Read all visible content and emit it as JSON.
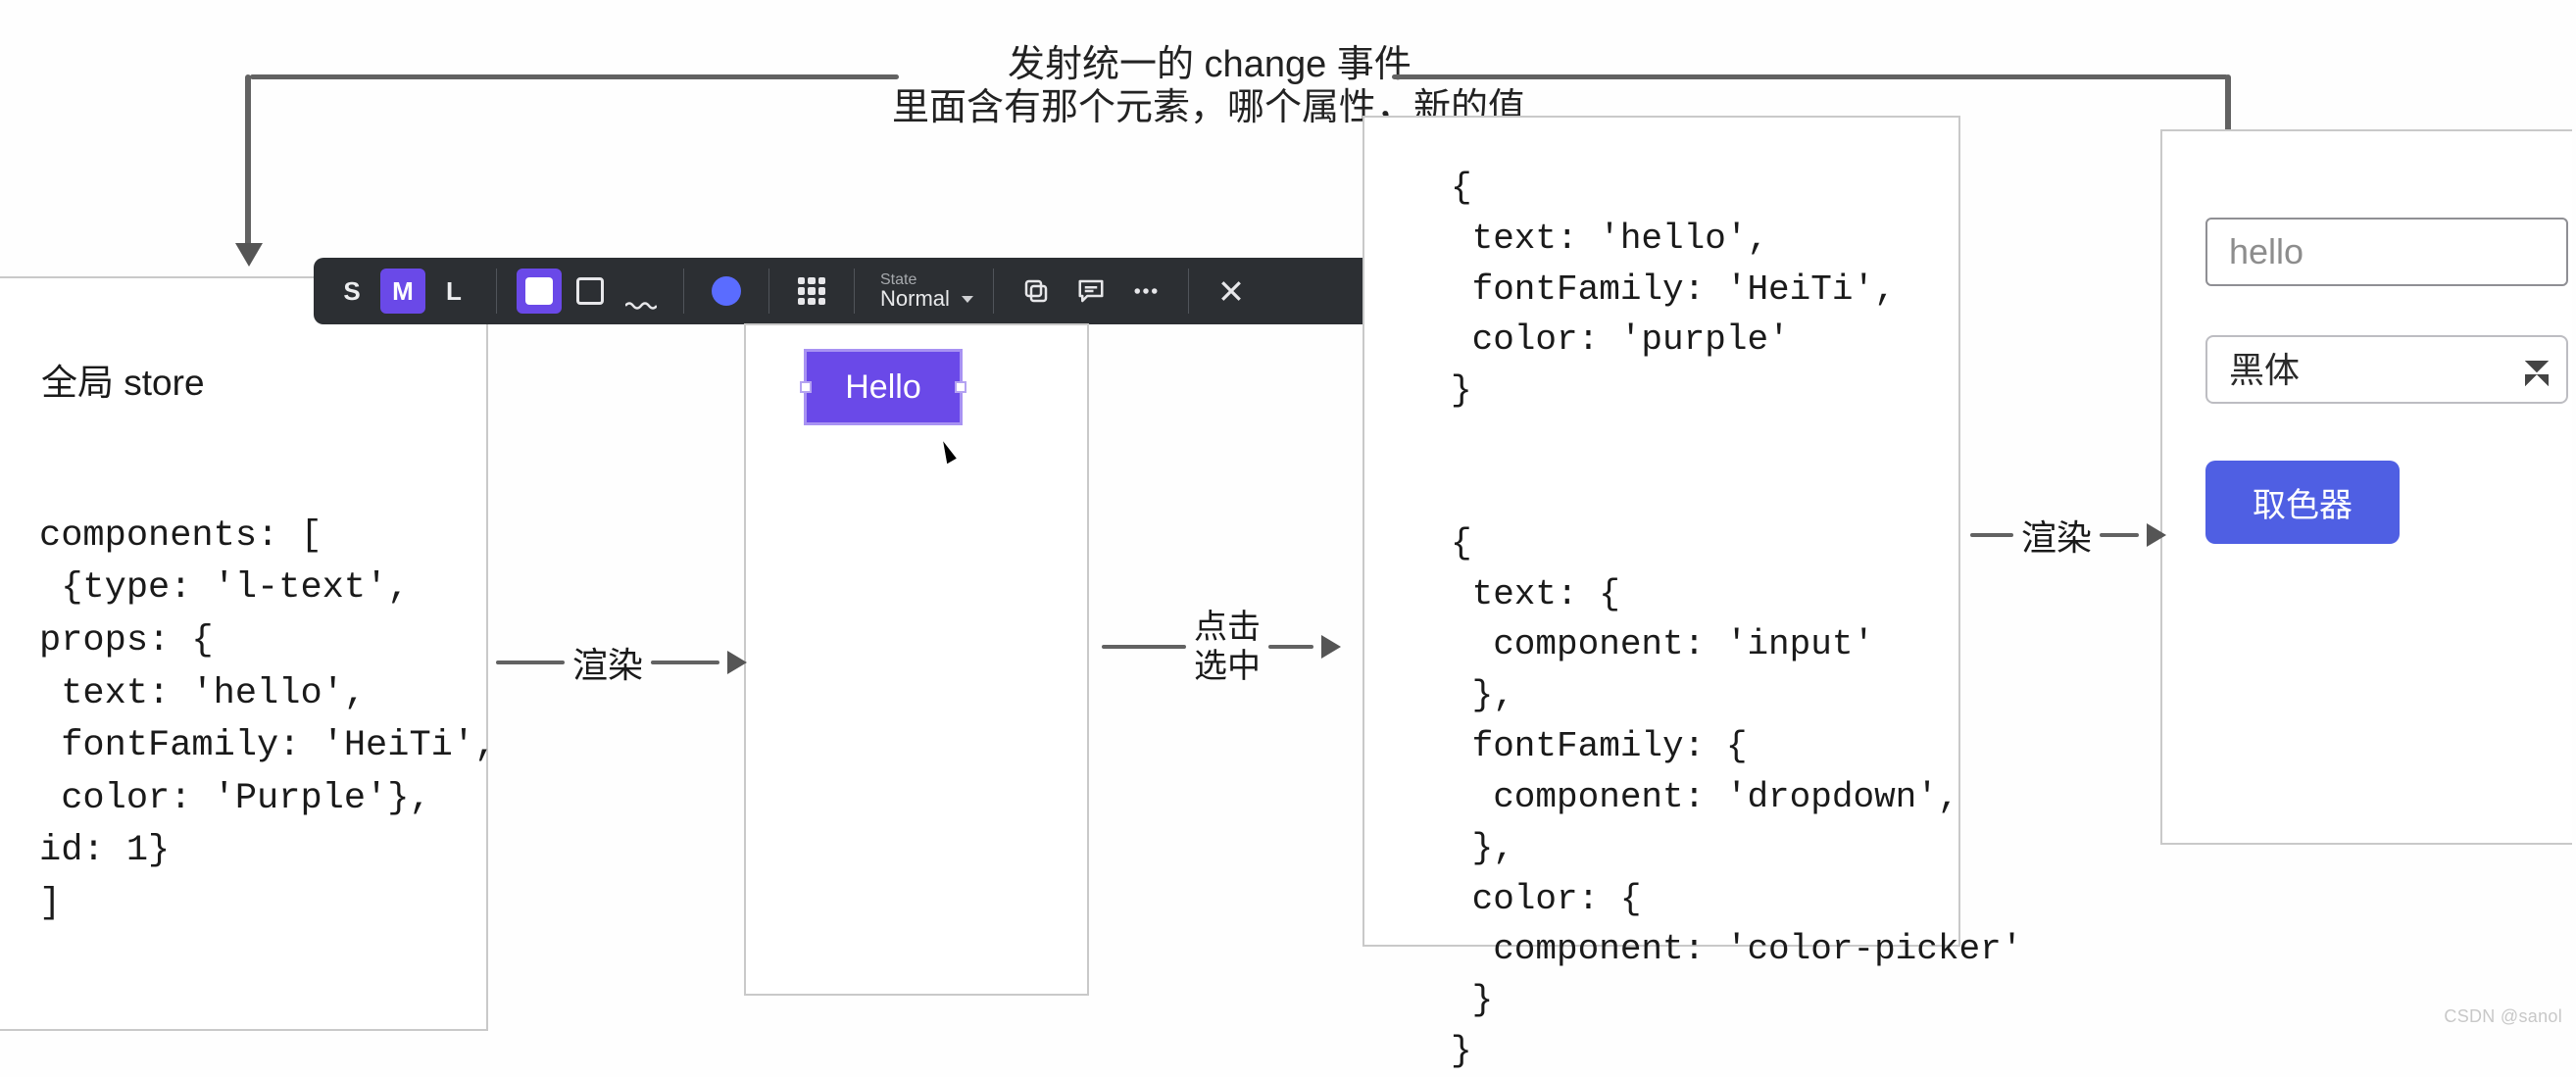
{
  "annotations": {
    "line1": "发射统一的 change 事件",
    "line2": "里面含有那个元素，哪个属性，新的值"
  },
  "store": {
    "title": "全局 store",
    "code_lines": [
      "",
      "components: [",
      " {type: 'l-text',",
      "props: {",
      " text: 'hello',",
      " fontFamily: 'HeiTi',",
      " color: 'Purple'},",
      "id: 1}",
      "]"
    ]
  },
  "toolbar": {
    "sizes": {
      "s": "S",
      "m": "M",
      "l": "L",
      "selected": "M"
    },
    "state": {
      "label": "State",
      "value": "Normal"
    }
  },
  "canvas": {
    "hello_label": "Hello"
  },
  "flows": {
    "render": "渲染",
    "click_select_1": "点击",
    "click_select_2": "选中",
    "render2": "渲染"
  },
  "mapping_json_lines": [
    "{",
    " text: 'hello',",
    " fontFamily: 'HeiTi',",
    " color: 'purple'",
    "}",
    "",
    "",
    "{",
    " text: {",
    "  component: 'input'",
    " },",
    " fontFamily: {",
    "  component: 'dropdown',",
    " },",
    " color: {",
    "  component: 'color-picker'",
    " }",
    "}"
  ],
  "form": {
    "text_value": "hello",
    "select_value": "黑体",
    "color_picker_label": "取色器"
  },
  "watermark": "CSDN @sanol"
}
